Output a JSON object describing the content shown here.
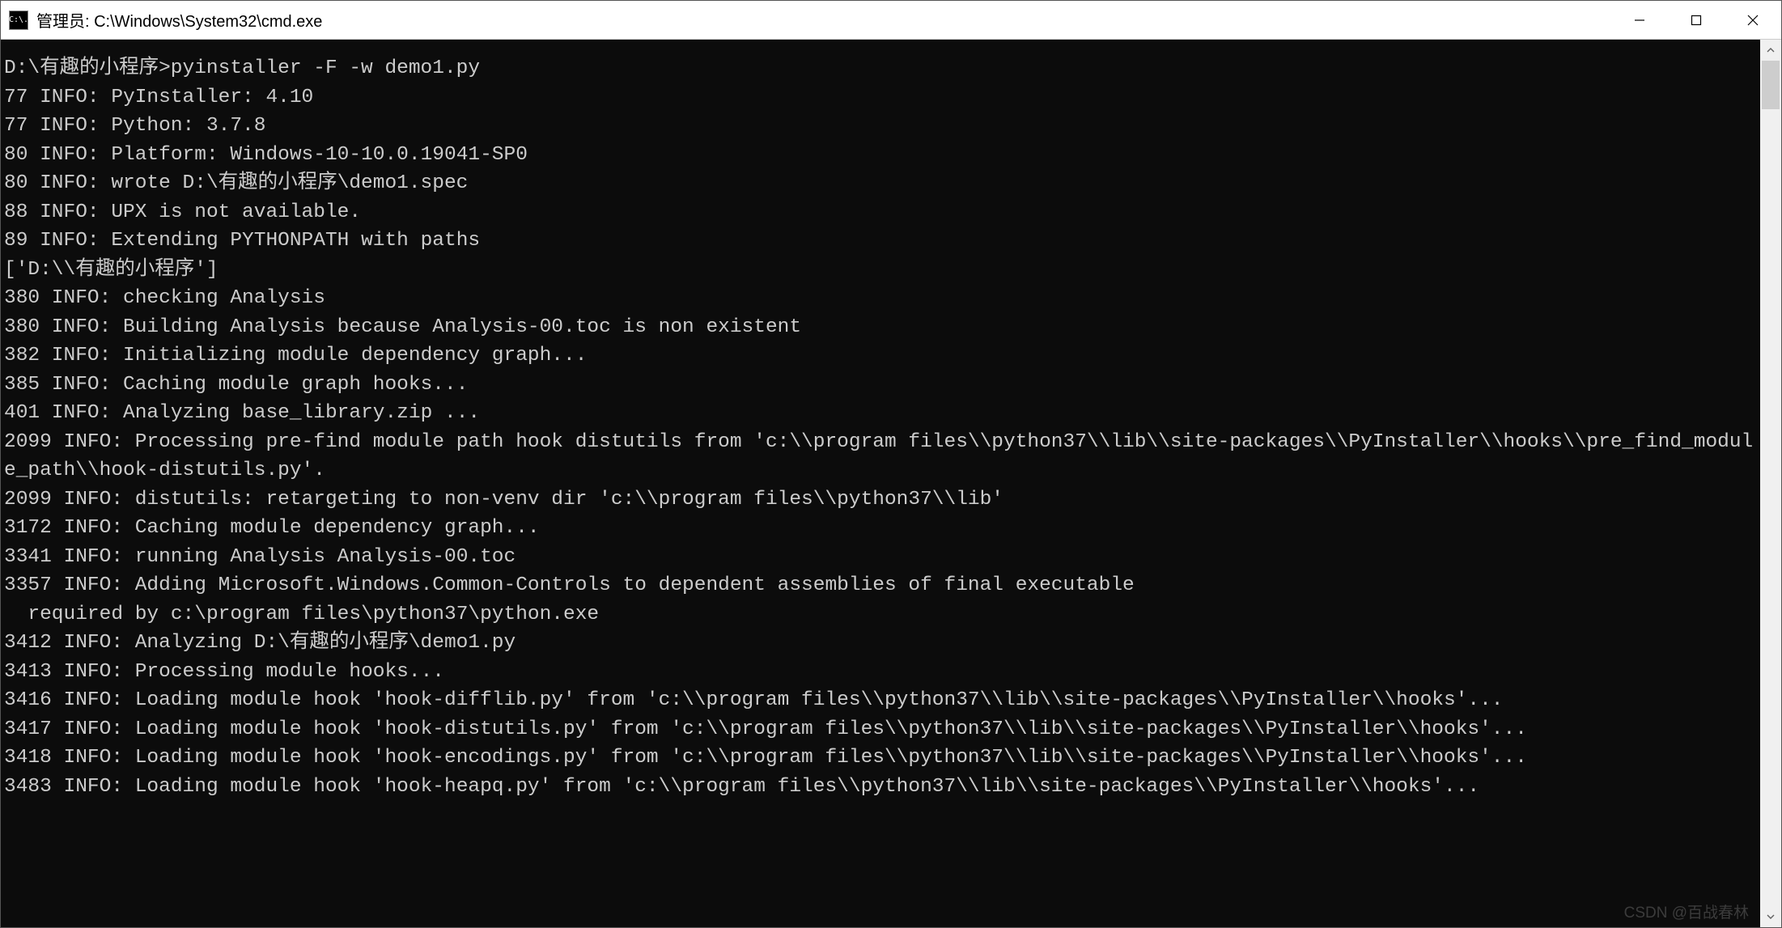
{
  "titlebar": {
    "icon_text": "C:\\.",
    "title": "管理员: C:\\Windows\\System32\\cmd.exe"
  },
  "console": {
    "lines": [
      "D:\\有趣的小程序>pyinstaller -F -w demo1.py",
      "77 INFO: PyInstaller: 4.10",
      "77 INFO: Python: 3.7.8",
      "80 INFO: Platform: Windows-10-10.0.19041-SP0",
      "80 INFO: wrote D:\\有趣的小程序\\demo1.spec",
      "88 INFO: UPX is not available.",
      "89 INFO: Extending PYTHONPATH with paths",
      "['D:\\\\有趣的小程序']",
      "380 INFO: checking Analysis",
      "380 INFO: Building Analysis because Analysis-00.toc is non existent",
      "382 INFO: Initializing module dependency graph...",
      "385 INFO: Caching module graph hooks...",
      "401 INFO: Analyzing base_library.zip ...",
      "2099 INFO: Processing pre-find module path hook distutils from 'c:\\\\program files\\\\python37\\\\lib\\\\site-packages\\\\PyInstaller\\\\hooks\\\\pre_find_module_path\\\\hook-distutils.py'.",
      "2099 INFO: distutils: retargeting to non-venv dir 'c:\\\\program files\\\\python37\\\\lib'",
      "3172 INFO: Caching module dependency graph...",
      "3341 INFO: running Analysis Analysis-00.toc",
      "3357 INFO: Adding Microsoft.Windows.Common-Controls to dependent assemblies of final executable",
      "  required by c:\\program files\\python37\\python.exe",
      "3412 INFO: Analyzing D:\\有趣的小程序\\demo1.py",
      "3413 INFO: Processing module hooks...",
      "3416 INFO: Loading module hook 'hook-difflib.py' from 'c:\\\\program files\\\\python37\\\\lib\\\\site-packages\\\\PyInstaller\\\\hooks'...",
      "3417 INFO: Loading module hook 'hook-distutils.py' from 'c:\\\\program files\\\\python37\\\\lib\\\\site-packages\\\\PyInstaller\\\\hooks'...",
      "3418 INFO: Loading module hook 'hook-encodings.py' from 'c:\\\\program files\\\\python37\\\\lib\\\\site-packages\\\\PyInstaller\\\\hooks'...",
      "3483 INFO: Loading module hook 'hook-heapq.py' from 'c:\\\\program files\\\\python37\\\\lib\\\\site-packages\\\\PyInstaller\\\\hooks'..."
    ]
  },
  "watermark": "CSDN @百战春林"
}
